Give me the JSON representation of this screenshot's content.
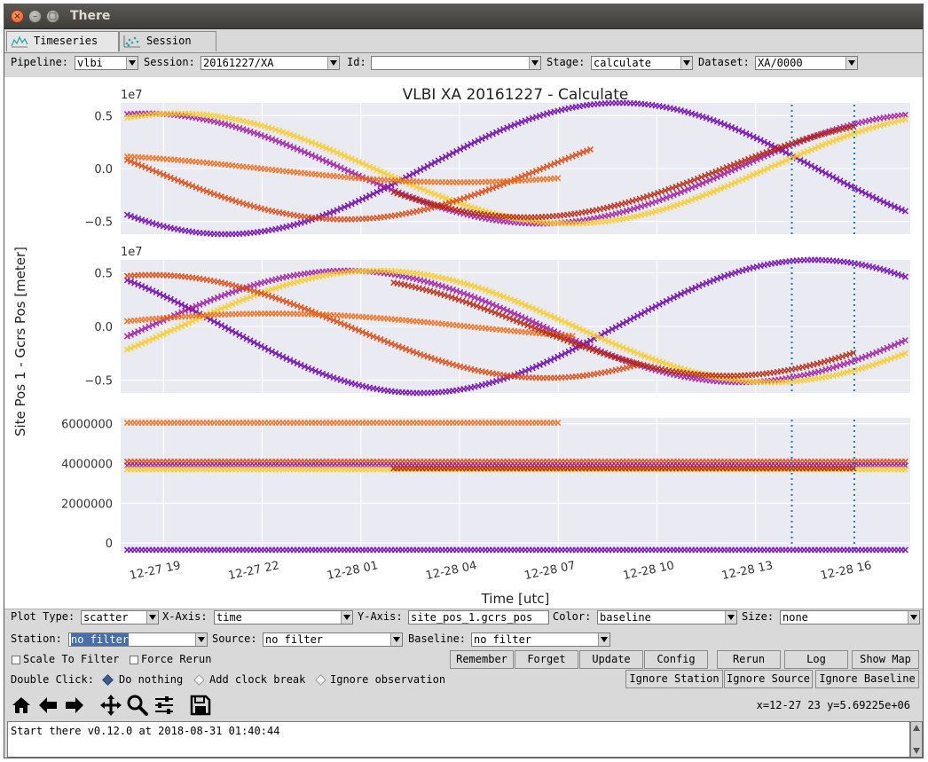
{
  "window": {
    "title": "There"
  },
  "tabs": [
    {
      "label": "Timeseries",
      "active": true,
      "icon": "timeseries-icon"
    },
    {
      "label": "Session",
      "active": false,
      "icon": "scatter-icon"
    }
  ],
  "filters": {
    "pipeline_label": "Pipeline:",
    "pipeline_value": "vlbi",
    "session_label": "Session:",
    "session_value": "20161227/XA",
    "id_label": "Id:",
    "id_value": "",
    "stage_label": "Stage:",
    "stage_value": "calculate",
    "dataset_label": "Dataset:",
    "dataset_value": "XA/0000"
  },
  "plot_controls": {
    "plot_type_label": "Plot Type:",
    "plot_type_value": "scatter",
    "x_axis_label": "X-Axis:",
    "x_axis_value": "time",
    "y_axis_label": "Y-Axis:",
    "y_axis_value": "site_pos_1.gcrs_pos",
    "color_label": "Color:",
    "color_value": "baseline",
    "size_label": "Size:",
    "size_value": "none",
    "station_label": "Station:",
    "station_value": "no filter",
    "source_label": "Source:",
    "source_value": "no filter",
    "baseline_label": "Baseline:",
    "baseline_value": "no filter",
    "scale_to_filter": "Scale To Filter",
    "force_rerun": "Force Rerun"
  },
  "buttons": {
    "remember": "Remember",
    "forget": "Forget",
    "update": "Update",
    "config": "Config",
    "rerun": "Rerun",
    "log": "Log",
    "show_map": "Show Map",
    "ignore_station": "Ignore Station",
    "ignore_source": "Ignore Source",
    "ignore_baseline": "Ignore Baseline"
  },
  "double_click": {
    "label": "Double Click:",
    "options": [
      {
        "label": "Do nothing",
        "selected": true
      },
      {
        "label": "Add clock break",
        "selected": false
      },
      {
        "label": "Ignore observation",
        "selected": false
      }
    ]
  },
  "toolbar": {
    "icons": [
      "home-icon",
      "back-icon",
      "forward-icon",
      "pan-icon",
      "zoom-icon",
      "configure-subplots-icon",
      "save-icon"
    ],
    "coordinates": "x=12-27 23 y=5.69225e+06"
  },
  "console": {
    "text": "Start there v0.12.0 at 2018-08-31 01:40:44"
  },
  "chart_data": {
    "type": "scatter",
    "title": "VLBI XA 20161227 - Calculate",
    "xlabel": "Time [utc]",
    "ylabel": "Site Pos 1 - Gcrs Pos [meter]",
    "x_ticks": [
      "12-27 19",
      "12-27 22",
      "12-28 01",
      "12-28 04",
      "12-28 07",
      "12-28 10",
      "12-28 13",
      "12-28 16"
    ],
    "x_range_hours": [
      17.7,
      41.7
    ],
    "vlines_hours": [
      38.1,
      40.0
    ],
    "grid": true,
    "palette": [
      "#3b0f70",
      "#6a00a8",
      "#9c179e",
      "#c62b78",
      "#b32107",
      "#d8440b",
      "#ea6b16",
      "#f7a21c",
      "#fccb21"
    ],
    "panels": [
      {
        "name": "x",
        "scale": "1e7",
        "y_ticks": [
          "0.5",
          "0.0",
          "−0.5"
        ],
        "y_tick_values": [
          0.5,
          0.0,
          -0.5
        ],
        "ylim": [
          -0.62,
          0.62
        ],
        "series": [
          {
            "color": "#6a00a8",
            "amp": 0.62,
            "phase": 2.3,
            "x_range_hours": [
              17.9,
              41.6
            ]
          },
          {
            "color": "#9c179e",
            "amp": 0.52,
            "phase": -0.2,
            "x_range_hours": [
              17.9,
              41.6
            ]
          },
          {
            "color": "#fccb21",
            "amp": 0.52,
            "phase": -0.45,
            "x_range_hours": [
              17.9,
              41.6
            ]
          },
          {
            "color": "#d8440b",
            "amp": 0.48,
            "phase": 1.35,
            "x_range_hours": [
              17.9,
              32.0
            ]
          },
          {
            "color": "#ea6b16",
            "amp": 0.13,
            "phase": 0.45,
            "x_range_hours": [
              17.9,
              31.0
            ]
          },
          {
            "color": "#b32107",
            "amp": 0.46,
            "phase": -0.1,
            "x_range_hours": [
              26.0,
              40.0
            ]
          }
        ]
      },
      {
        "name": "y",
        "scale": "1e7",
        "y_ticks": [
          "0.5",
          "0.0",
          "−0.5"
        ],
        "y_tick_values": [
          0.5,
          0.0,
          -0.5
        ],
        "ylim": [
          -0.62,
          0.62
        ],
        "series": [
          {
            "color": "#6a00a8",
            "amp": 0.62,
            "phase": 0.75,
            "x_range_hours": [
              17.9,
              41.6
            ]
          },
          {
            "color": "#9c179e",
            "amp": 0.52,
            "phase": -1.8,
            "x_range_hours": [
              17.9,
              41.6
            ]
          },
          {
            "color": "#fccb21",
            "amp": 0.52,
            "phase": -2.05,
            "x_range_hours": [
              17.9,
              41.6
            ]
          },
          {
            "color": "#d8440b",
            "amp": 0.48,
            "phase": -0.25,
            "x_range_hours": [
              17.9,
              33.5
            ]
          },
          {
            "color": "#ea6b16",
            "amp": 0.12,
            "phase": -1.2,
            "x_range_hours": [
              17.9,
              31.5
            ]
          },
          {
            "color": "#b32107",
            "amp": 0.46,
            "phase": -1.7,
            "x_range_hours": [
              26.0,
              40.0
            ]
          }
        ]
      },
      {
        "name": "z",
        "scale": "",
        "y_ticks": [
          "6000000",
          "4000000",
          "2000000",
          "0"
        ],
        "y_tick_values": [
          6000000,
          4000000,
          2000000,
          0
        ],
        "ylim": [
          -400000,
          6300000
        ],
        "series": [
          {
            "color": "#6a00a8",
            "y": -350000,
            "x_range_hours": [
              17.9,
              41.6
            ]
          },
          {
            "color": "#ea6b16",
            "y": 6050000,
            "x_range_hours": [
              17.9,
              31.0
            ]
          },
          {
            "color": "#d8440b",
            "y": 4100000,
            "x_range_hours": [
              17.9,
              41.6
            ]
          },
          {
            "color": "#9c179e",
            "y": 3900000,
            "x_range_hours": [
              17.9,
              41.6
            ]
          },
          {
            "color": "#fccb21",
            "y": 3700000,
            "x_range_hours": [
              17.9,
              41.6
            ]
          },
          {
            "color": "#b32107",
            "y": 3750000,
            "x_range_hours": [
              26.0,
              40.0
            ]
          }
        ]
      }
    ]
  }
}
